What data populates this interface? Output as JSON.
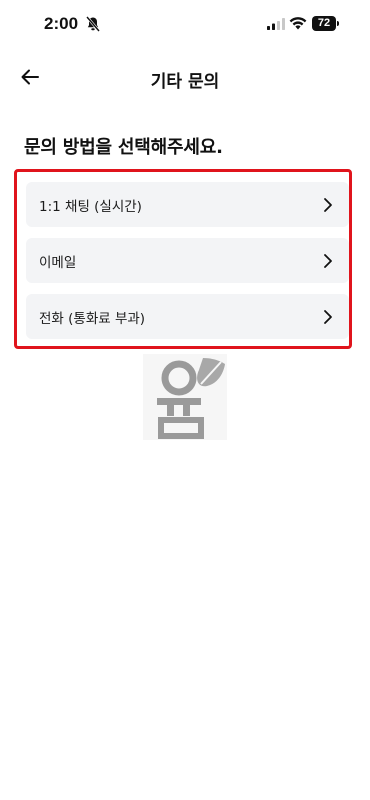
{
  "status_bar": {
    "time": "2:00",
    "battery": "72",
    "icons": [
      "bell-off-icon",
      "signal-icon",
      "wifi-icon",
      "battery-icon"
    ]
  },
  "header": {
    "title": "기타 문의",
    "back_icon": "back-arrow-icon"
  },
  "heading": "문의 방법을 선택해주세요.",
  "options": [
    {
      "label": "1:1 채팅 (실시간)",
      "icon": "chevron-right-icon"
    },
    {
      "label": "이메일",
      "icon": "chevron-right-icon"
    },
    {
      "label": "전화 (통화료 부과)",
      "icon": "chevron-right-icon"
    }
  ],
  "colors": {
    "highlight_border": "#e0141c",
    "option_bg": "#f3f4f6"
  }
}
